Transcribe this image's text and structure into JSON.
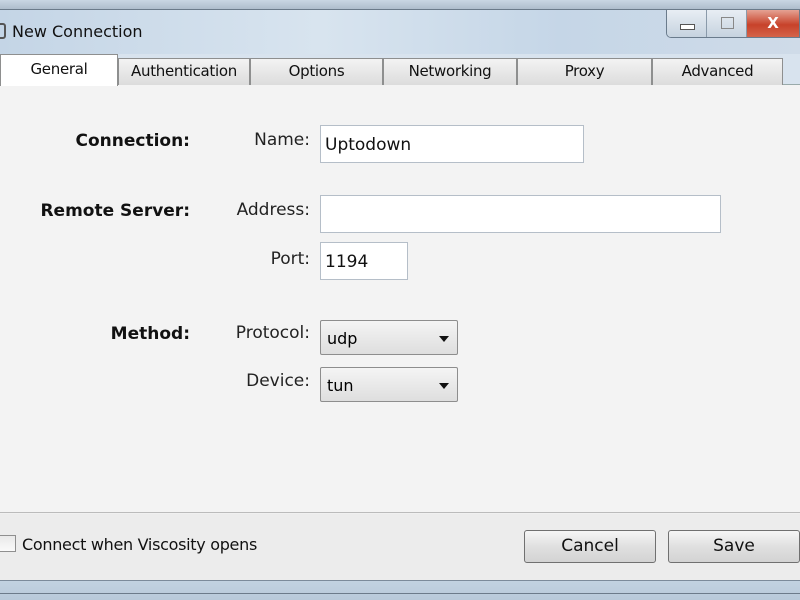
{
  "window": {
    "title": "New Connection",
    "close_label": "X"
  },
  "tabs": [
    {
      "label": "General",
      "active": true
    },
    {
      "label": "Authentication"
    },
    {
      "label": "Options"
    },
    {
      "label": "Networking"
    },
    {
      "label": "Proxy"
    },
    {
      "label": "Advanced"
    }
  ],
  "form": {
    "connection": {
      "section": "Connection:",
      "name_label": "Name:",
      "name_value": "Uptodown"
    },
    "remote": {
      "section": "Remote Server:",
      "address_label": "Address:",
      "address_value": "",
      "port_label": "Port:",
      "port_value": "1194"
    },
    "method": {
      "section": "Method:",
      "protocol_label": "Protocol:",
      "protocol_value": "udp",
      "device_label": "Device:",
      "device_value": "tun"
    }
  },
  "footer": {
    "checkbox_label": "Connect when Viscosity opens",
    "checked": false,
    "cancel": "Cancel",
    "save": "Save"
  }
}
